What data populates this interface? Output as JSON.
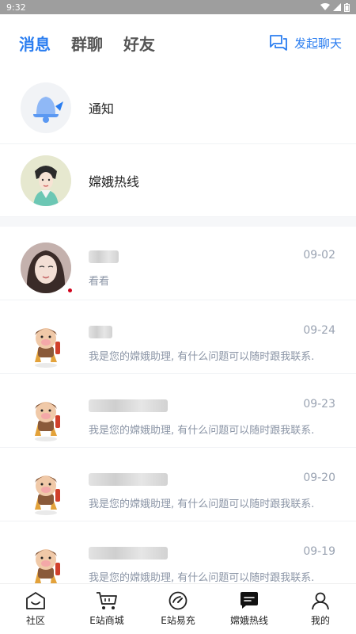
{
  "status_bar": {
    "time": "9:32"
  },
  "tabs": [
    {
      "label": "消息",
      "active": true
    },
    {
      "label": "群聊",
      "active": false
    },
    {
      "label": "好友",
      "active": false
    }
  ],
  "start_chat": {
    "label": "发起聊天"
  },
  "system_items": [
    {
      "label": "通知",
      "icon": "bell-icon"
    },
    {
      "label": "嫦娥热线",
      "icon": "change-avatar"
    }
  ],
  "messages": [
    {
      "date": "09-02",
      "preview": "看看",
      "unread": true,
      "avatar": "woman-avatar"
    },
    {
      "date": "09-24",
      "preview": "我是您的嫦娥助理, 有什么问题可以随时跟我联系.",
      "unread": false,
      "avatar": "mascot-avatar"
    },
    {
      "date": "09-23",
      "preview": "我是您的嫦娥助理, 有什么问题可以随时跟我联系.",
      "unread": false,
      "avatar": "mascot-avatar"
    },
    {
      "date": "09-20",
      "preview": "我是您的嫦娥助理, 有什么问题可以随时跟我联系.",
      "unread": false,
      "avatar": "mascot-avatar"
    },
    {
      "date": "09-19",
      "preview": "我是您的嫦娥助理, 有什么问题可以随时跟我联系.",
      "unread": false,
      "avatar": "mascot-avatar"
    }
  ],
  "bottom_nav": [
    {
      "label": "社区",
      "icon": "community-icon",
      "active": false
    },
    {
      "label": "E站商城",
      "icon": "cart-icon",
      "active": false
    },
    {
      "label": "E站易充",
      "icon": "gauge-icon",
      "active": false
    },
    {
      "label": "嫦娥热线",
      "icon": "chat-icon",
      "active": true
    },
    {
      "label": "我的",
      "icon": "profile-icon",
      "active": false
    }
  ],
  "colors": {
    "accent": "#2a7df0",
    "unread_dot": "#d0021b",
    "date": "#9aa3b2",
    "status_bar": "#9e9e9e"
  }
}
